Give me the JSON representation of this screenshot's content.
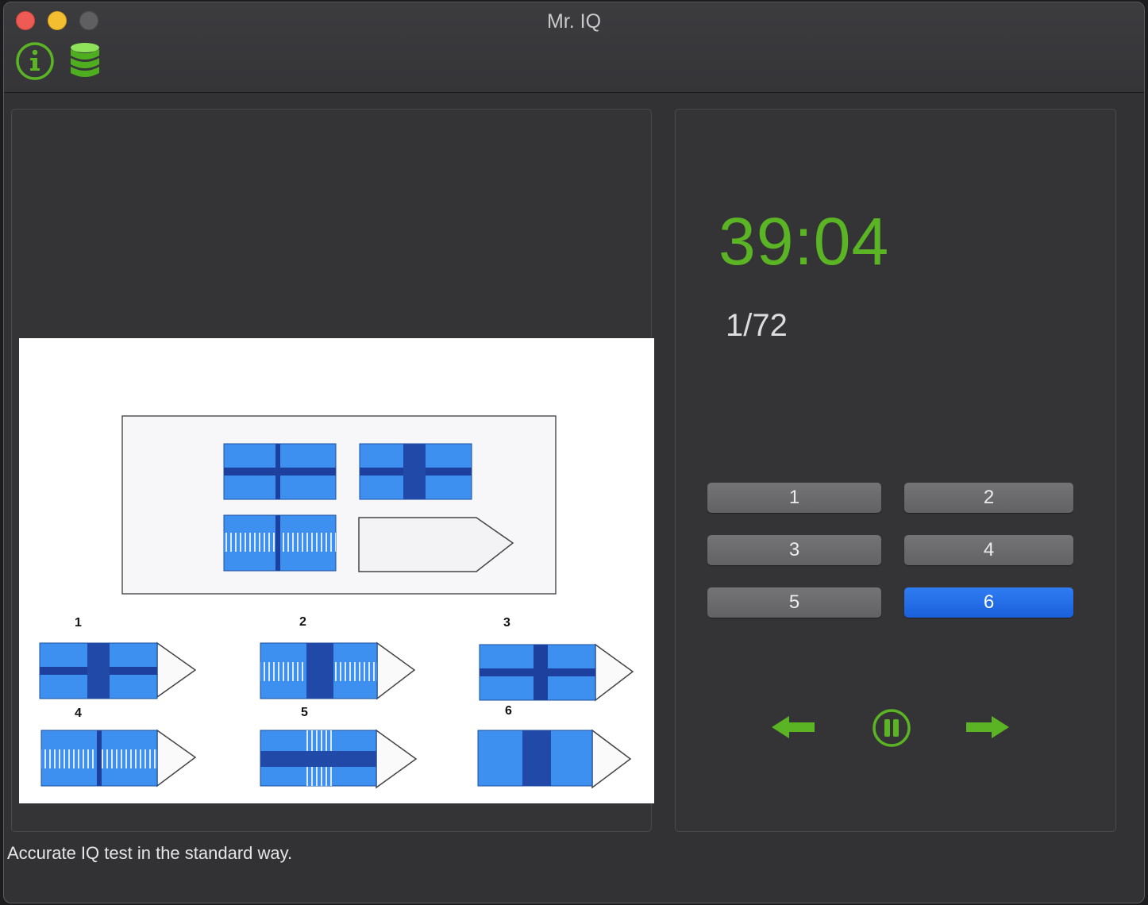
{
  "window": {
    "title": "Mr. IQ"
  },
  "toolbar": {
    "icons": [
      "info-icon",
      "database-icon"
    ],
    "accent_color": "#5ab424"
  },
  "question": {
    "option_labels": [
      "1",
      "2",
      "3",
      "4",
      "5",
      "6"
    ]
  },
  "timer": {
    "value": "39:04",
    "color": "#5ab424"
  },
  "progress": {
    "text": "1/72"
  },
  "answers": {
    "buttons": [
      {
        "label": "1",
        "selected": false
      },
      {
        "label": "2",
        "selected": false
      },
      {
        "label": "3",
        "selected": false
      },
      {
        "label": "4",
        "selected": false
      },
      {
        "label": "5",
        "selected": false
      },
      {
        "label": "6",
        "selected": true
      }
    ],
    "selected_color": "#1a60db"
  },
  "navigation": {
    "icons": [
      "arrow-left-icon",
      "pause-icon",
      "arrow-right-icon"
    ]
  },
  "status": {
    "text": "Accurate IQ test in the standard way."
  }
}
